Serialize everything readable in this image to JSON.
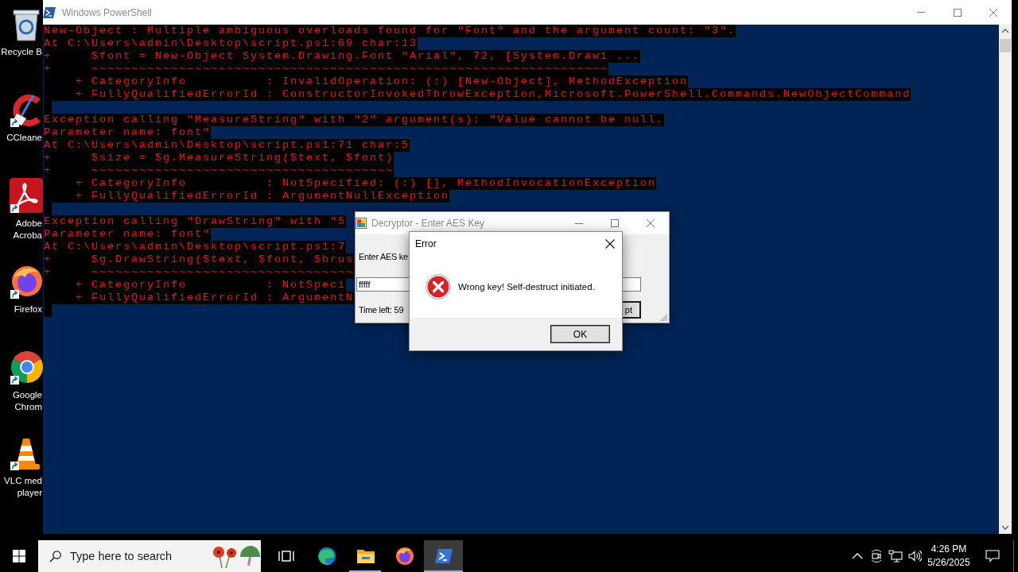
{
  "desktop_icons": [
    {
      "label": "Recycle B",
      "shortcut": false
    },
    {
      "label": "CCleane",
      "shortcut": true
    },
    {
      "label": "Adobe Acroba",
      "shortcut": true
    },
    {
      "label": "Firefox",
      "shortcut": true
    },
    {
      "label": "Google Chrom",
      "shortcut": true
    },
    {
      "label": "VLC med player",
      "shortcut": true
    }
  ],
  "powershell_window": {
    "title": "Windows PowerShell",
    "active": false,
    "lines": [
      {
        "kind": "error",
        "text": "New-Object : Multiple ambiguous overloads found for \"Font\" and the argument count: \"3\"."
      },
      {
        "kind": "error",
        "text": "At C:\\Users\\admin\\Desktop\\script.ps1:69 char:13"
      },
      {
        "kind": "error",
        "text": "+     $font = New-Object System.Drawing.Font \"Arial\", 72, [System.Drawi ..."
      },
      {
        "kind": "error",
        "text": "+     ~~~~~~~~~~~~~~~~~~~~~~~~~~~~~~~~~~~~~~~~~~~~~~~~~~~~~~~~~~~~~~~~~"
      },
      {
        "kind": "error",
        "text": "    + CategoryInfo          : InvalidOperation: (:) [New-Object], MethodException"
      },
      {
        "kind": "error",
        "text": "    + FullyQualifiedErrorId : ConstructorInvokedThrowException,Microsoft.PowerShell.Commands.NewObjectCommand"
      },
      {
        "kind": "blank"
      },
      {
        "kind": "error",
        "text": "Exception calling \"MeasureString\" with \"2\" argument(s): \"Value cannot be null."
      },
      {
        "kind": "error",
        "text": "Parameter name: font\""
      },
      {
        "kind": "error",
        "text": "At C:\\Users\\admin\\Desktop\\script.ps1:71 char:5"
      },
      {
        "kind": "error",
        "text": "+     $size = $g.MeasureString($text, $font)"
      },
      {
        "kind": "error",
        "text": "+     ~~~~~~~~~~~~~~~~~~~~~~~~~~~~~~~~~~~~~~"
      },
      {
        "kind": "error",
        "text": "    + CategoryInfo          : NotSpecified: (:) [], MethodInvocationException"
      },
      {
        "kind": "error",
        "text": "    + FullyQualifiedErrorId : ArgumentNullException"
      },
      {
        "kind": "blank"
      },
      {
        "kind": "error",
        "text": "Exception calling \"DrawString\" with \"5"
      },
      {
        "kind": "error",
        "text": "Parameter name: font\""
      },
      {
        "kind": "error",
        "text": "At C:\\Users\\admin\\Desktop\\script.ps1:7"
      },
      {
        "kind": "error",
        "text": "+     $g.DrawString($text, $font, $brus"
      },
      {
        "kind": "error",
        "text": "+     ~~~~~~~~~~~~~~~~~~~~~~~~~~~~~~~~~"
      },
      {
        "kind": "error",
        "text": "    + CategoryInfo          : NotSpeci"
      },
      {
        "kind": "error",
        "text": "    + FullyQualifiedErrorId : ArgumentN"
      },
      {
        "kind": "blank"
      }
    ]
  },
  "decryptor_window": {
    "title": "Decryptor - Enter AES Key",
    "active": false,
    "field_label": "Enter AES ke",
    "key_field": {
      "value": "fffff"
    },
    "timer": "Time left: 59",
    "button": "pt"
  },
  "error_dialog": {
    "title": "Error",
    "active": true,
    "message": "Wrong key! Self-destruct initiated.",
    "button": "OK"
  },
  "taskbar": {
    "search": {
      "placeholder": "Type here to search"
    },
    "apps": [
      {
        "running": false,
        "active": false
      },
      {
        "running": true,
        "active": false
      },
      {
        "running": false,
        "active": false
      },
      {
        "running": true,
        "active": true
      }
    ],
    "clock": {
      "time": "4:26 PM",
      "date": "5/26/2025"
    }
  }
}
